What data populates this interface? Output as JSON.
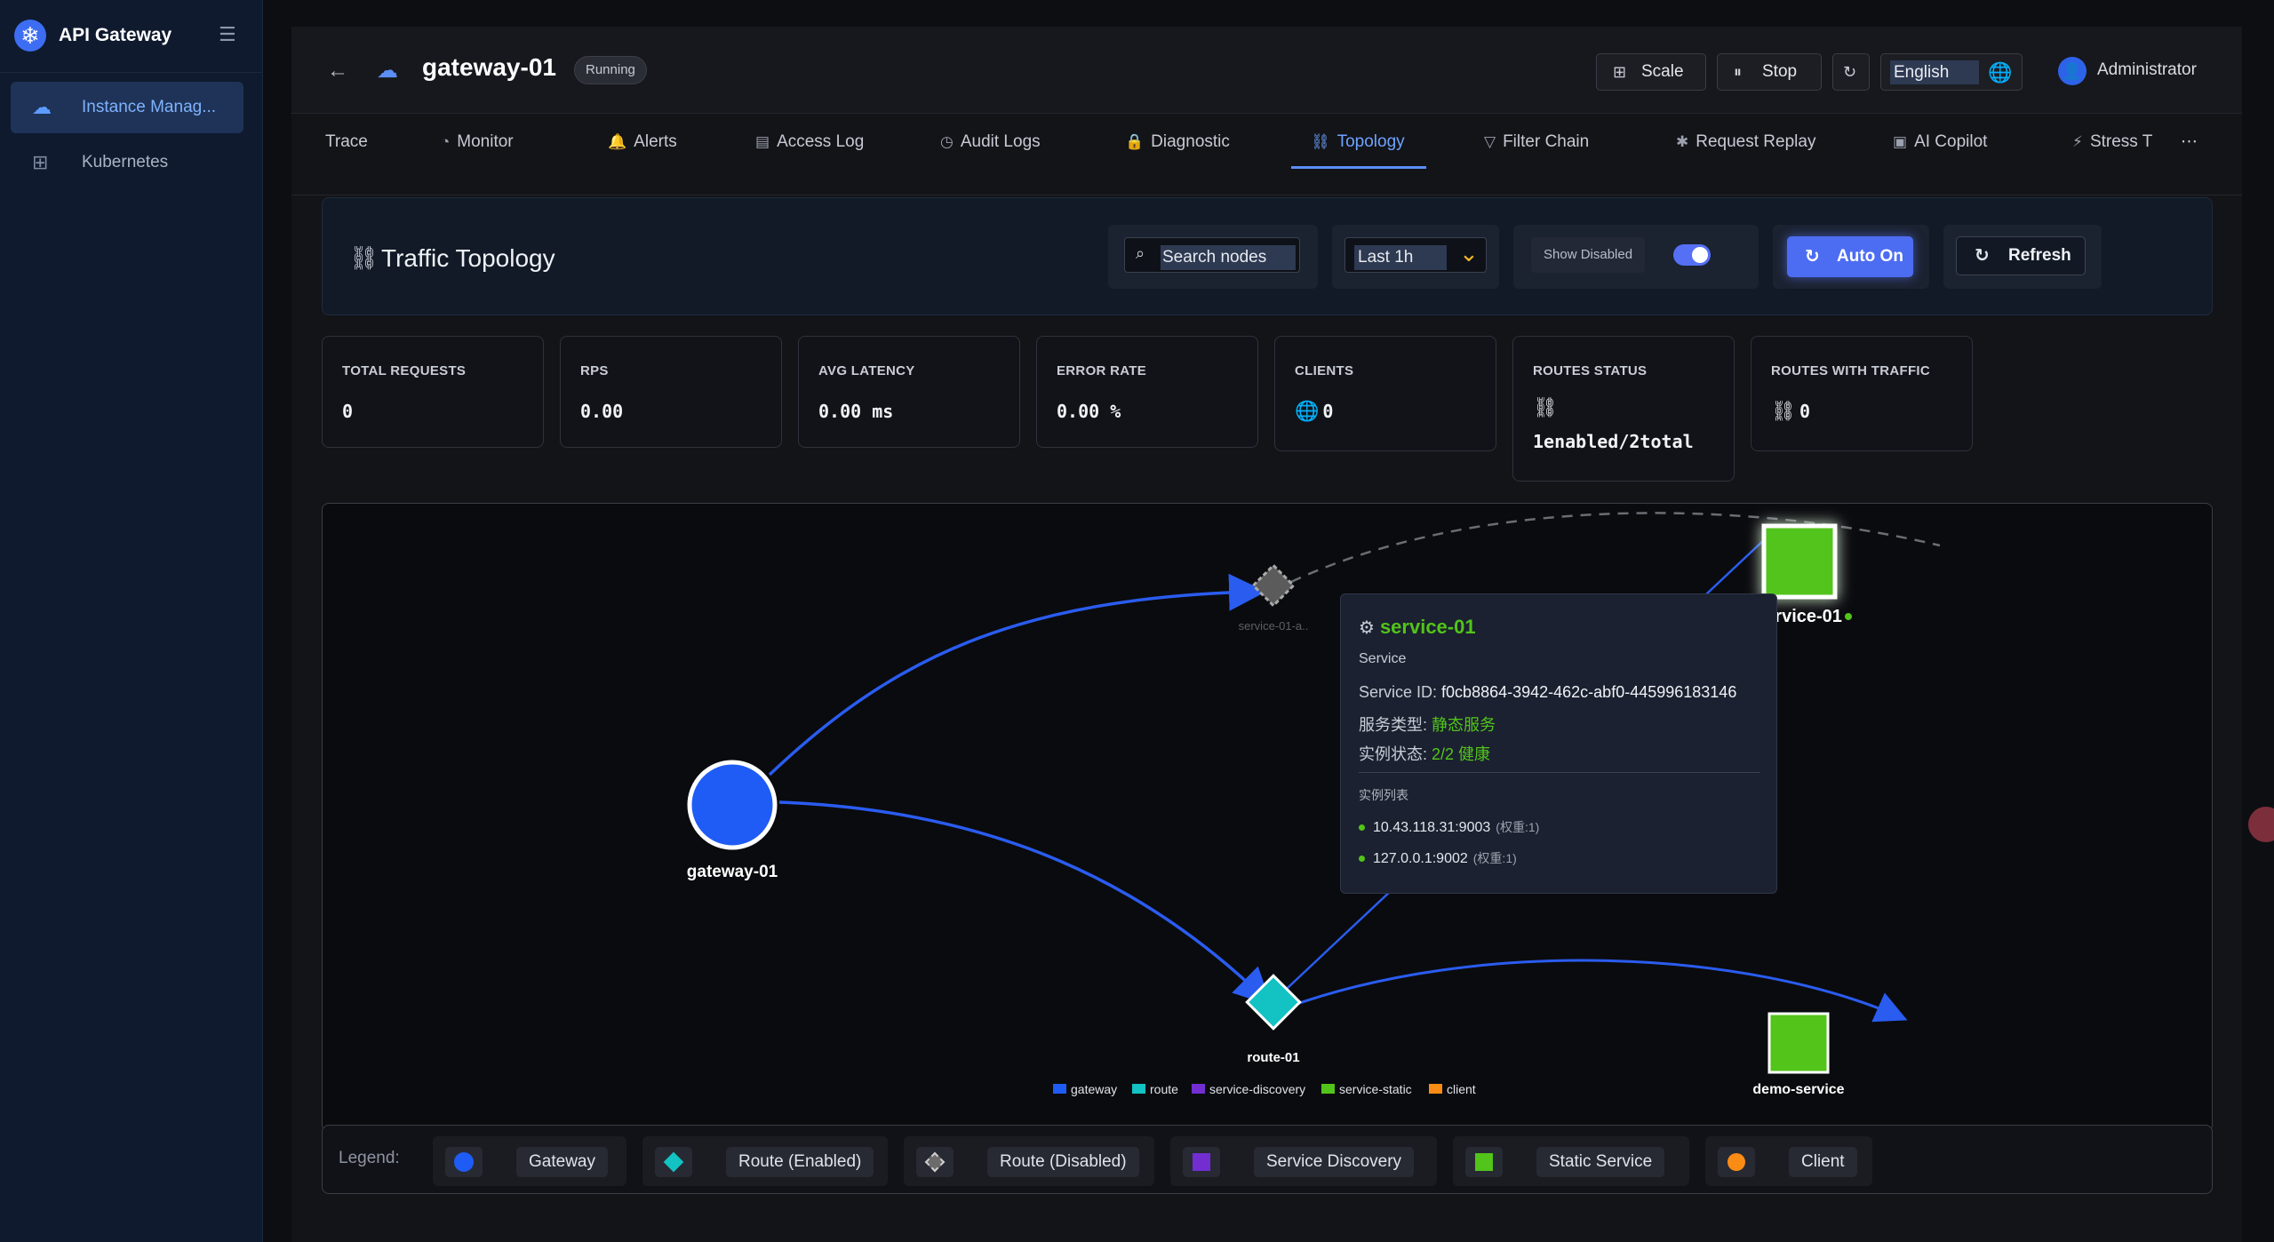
{
  "app": {
    "title": "API Gateway",
    "collapse_icon": "menu-fold-icon"
  },
  "sidebar": {
    "items": [
      {
        "label": "Instance Manag...",
        "icon": "cloud-server-icon",
        "active": true
      },
      {
        "label": "Kubernetes",
        "icon": "cluster-icon",
        "active": false
      }
    ]
  },
  "header": {
    "gateway_name": "gateway-01",
    "status": "Running",
    "scale_label": "Scale",
    "stop_label": "Stop",
    "language": "English",
    "user": "Administrator"
  },
  "tabs": [
    {
      "label": "Trace",
      "icon": ""
    },
    {
      "label": "Monitor",
      "icon": "dashboard-icon"
    },
    {
      "label": "Alerts",
      "icon": "bell-icon"
    },
    {
      "label": "Access Log",
      "icon": "file-icon"
    },
    {
      "label": "Audit Logs",
      "icon": "history-icon"
    },
    {
      "label": "Diagnostic",
      "icon": "lock-icon"
    },
    {
      "label": "Topology",
      "icon": "topology-icon",
      "active": true
    },
    {
      "label": "Filter Chain",
      "icon": "filter-icon"
    },
    {
      "label": "Request Replay",
      "icon": "bug-icon"
    },
    {
      "label": "AI Copilot",
      "icon": "robot-icon"
    },
    {
      "label": "Stress T",
      "icon": "thunder-icon"
    }
  ],
  "topology": {
    "title": "Traffic Topology",
    "search_placeholder": "Search nodes",
    "time_range": "Last 1h",
    "show_disabled_label": "Show Disabled",
    "show_disabled_on": true,
    "auto_label": "Auto On",
    "refresh_label": "Refresh"
  },
  "stats": [
    {
      "label": "TOTAL REQUESTS",
      "value": "0"
    },
    {
      "label": "RPS",
      "value": "0.00"
    },
    {
      "label": "AVG LATENCY",
      "value": "0.00 ms"
    },
    {
      "label": "ERROR RATE",
      "value": "0.00 %"
    },
    {
      "label": "CLIENTS",
      "value": "0",
      "icon": "global-icon"
    },
    {
      "label": "ROUTES STATUS",
      "value": "1enabled/2total",
      "icon": "api-icon"
    },
    {
      "label": "ROUTES WITH TRAFFIC",
      "value": "0",
      "icon": "api-icon"
    }
  ],
  "graph": {
    "nodes": {
      "gateway": "gateway-01",
      "route_disabled": "service-01-a..",
      "route_enabled": "route-01",
      "service_top": "service-01",
      "service_bottom": "demo-service"
    },
    "mini_legend": [
      "gateway",
      "route",
      "service-discovery",
      "service-static",
      "client"
    ]
  },
  "tooltip": {
    "title": "service-01",
    "type": "Service",
    "id_label": "Service ID:",
    "id_value": "f0cb8864-3942-462c-abf0-445996183146",
    "kind_label": "服务类型:",
    "kind_value": "静态服务",
    "state_label": "实例状态:",
    "state_value": "2/2 健康",
    "list_label": "实例列表",
    "instances": [
      {
        "addr": "10.43.118.31:9003",
        "weight": "(权重:1)"
      },
      {
        "addr": "127.0.0.1:9002",
        "weight": "(权重:1)"
      }
    ]
  },
  "legend": {
    "label": "Legend:",
    "items": [
      "Gateway",
      "Route (Enabled)",
      "Route (Disabled)",
      "Service Discovery",
      "Static Service",
      "Client"
    ]
  },
  "colors": {
    "gateway": "#1f5cf5",
    "route": "#13c2c2",
    "route_disabled": "#6b6b6b",
    "service_discovery": "#722ed1",
    "service_static": "#52c41a",
    "client": "#fa8c16",
    "edge": "#2a5cf0"
  }
}
